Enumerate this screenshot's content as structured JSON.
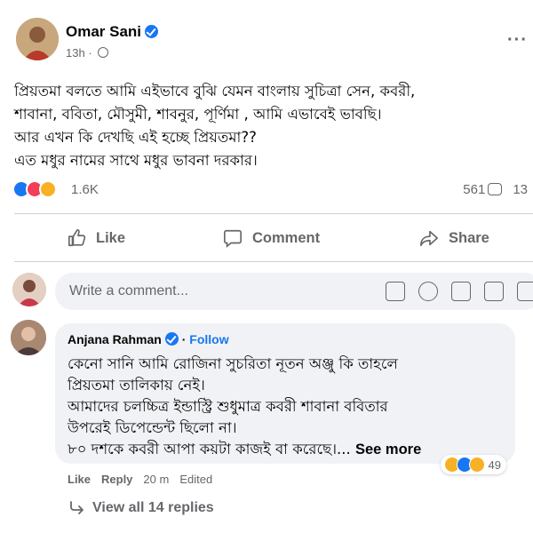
{
  "post": {
    "author": "Omar Sani",
    "time": "13h",
    "lines": [
      "প্রিয়তমা বলতে আমি এইভাবে বুঝি যেমন বাংলায় সুচিত্রা সেন, কবরী,",
      "শাবানা, ববিতা, মৌসুমী, শাবনুর, পূর্ণিমা , আমি এভাবেই ভাবছি।",
      "আর এখন কি দেখছি এই হচ্ছে প্রিয়তমা??",
      "এত মধুর নামের সাথে মধুর ভাবনা দরকার।"
    ],
    "reactions_count": "1.6K",
    "comments_count": "561",
    "shares_count": "13"
  },
  "actions": {
    "like": "Like",
    "comment": "Comment",
    "share": "Share"
  },
  "composer": {
    "placeholder": "Write a comment..."
  },
  "comment": {
    "author": "Anjana Rahman",
    "separator": " · ",
    "follow": "Follow",
    "lines": [
      "কেনো সানি আমি রোজিনা সুচরিতা নূতন অঞ্জু কি তাহলে",
      "প্রিয়তমা তালিকায় নেই।",
      "আমাদের চলচ্চিত্র ইন্ডাস্ট্রি শুধুমাত্র কবরী শাবানা ববিতার",
      "উপরেই ডিপেন্ডেন্ট ছিলো না।",
      "৮০ দশকে কবরী আপা কয়টা কাজই বা করেছে।..."
    ],
    "see_more": "See more",
    "reactions_count": "49",
    "like": "Like",
    "reply": "Reply",
    "time": "20 m",
    "edited": "Edited",
    "view_replies": "View all 14 replies"
  },
  "colors": {
    "accent": "#1877f2",
    "love": "#f33e58",
    "haha": "#f7b125",
    "muted": "#65676b"
  }
}
